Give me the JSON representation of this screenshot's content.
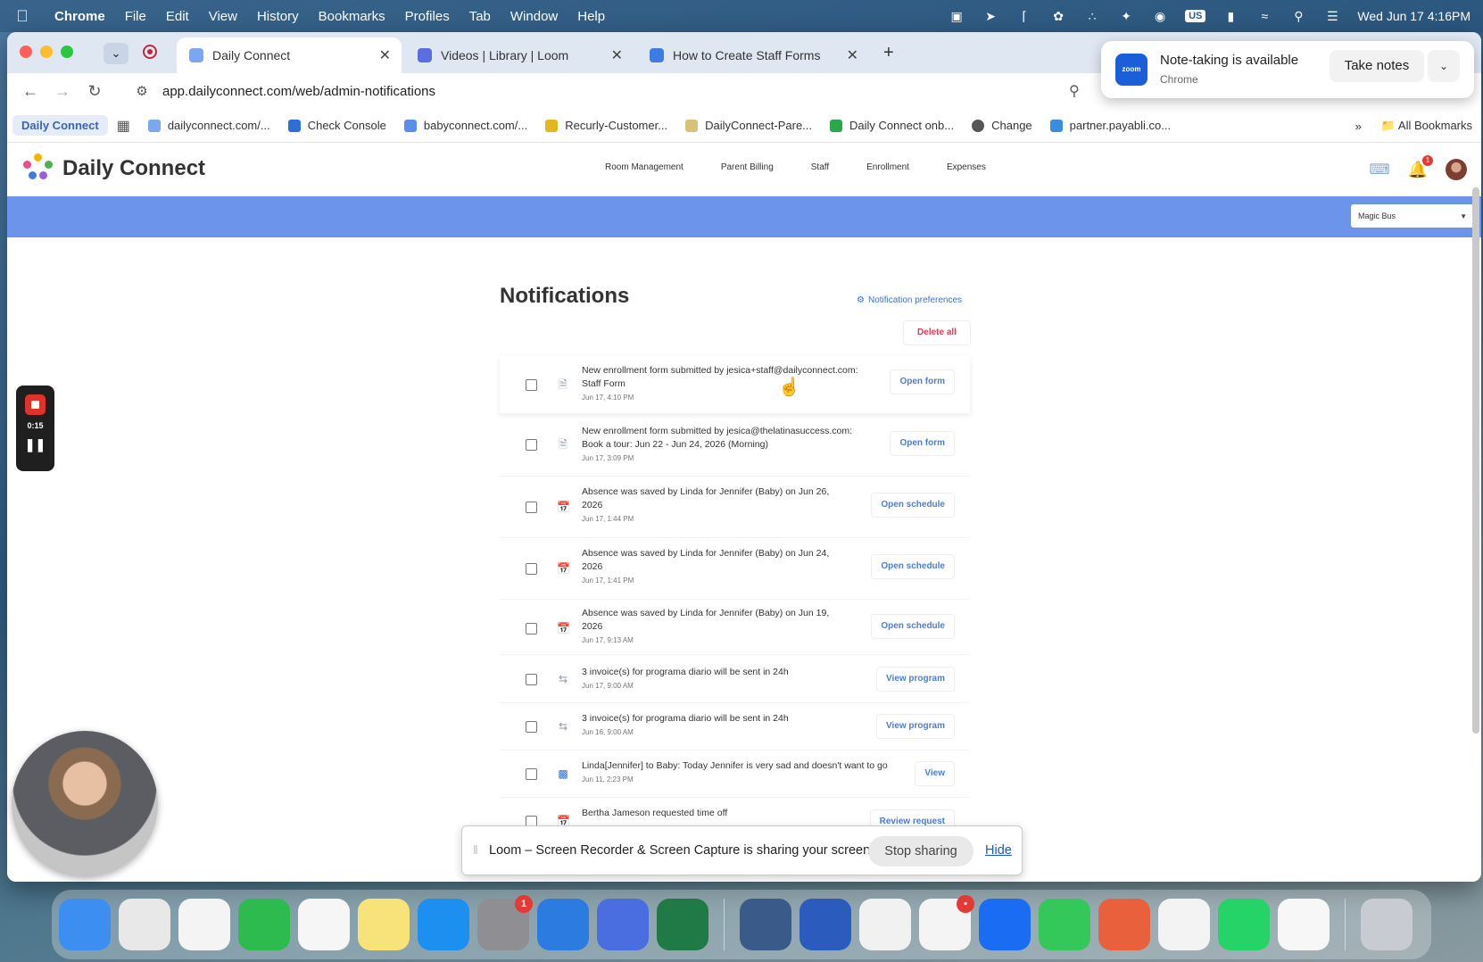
{
  "menubar": {
    "app": "Chrome",
    "items": [
      "File",
      "Edit",
      "View",
      "History",
      "Bookmarks",
      "Profiles",
      "Tab",
      "Window",
      "Help"
    ],
    "input_source": "US",
    "datetime": "Wed Jun 17  4:16PM"
  },
  "tabs": [
    {
      "title": "Daily Connect",
      "color": "#7aa7f0"
    },
    {
      "title": "Videos | Library | Loom",
      "color": "#5b6ee1"
    },
    {
      "title": "How to Create Staff Forms",
      "color": "#3f7be0"
    }
  ],
  "address": {
    "url": "app.dailyconnect.com/web/admin-notifications"
  },
  "bookmarks": [
    {
      "label": "Daily Connect"
    },
    {
      "label": "dailyconnect.com/...",
      "color": "#7aa7f0"
    },
    {
      "label": "Check Console",
      "color": "#2d6fd6"
    },
    {
      "label": "babyconnect.com/...",
      "color": "#5a8ee8"
    },
    {
      "label": "Recurly-Customer...",
      "color": "#e3b81d"
    },
    {
      "label": "DailyConnect-Pare...",
      "color": "#d8c27a"
    },
    {
      "label": "Daily Connect onb...",
      "color": "#2aa84a"
    },
    {
      "label": "Change",
      "color": "#555555"
    },
    {
      "label": "partner.payabli.co...",
      "color": "#3a8ee0"
    }
  ],
  "bookmarks_right": {
    "folder": "All Bookmarks"
  },
  "app": {
    "logo_text": "Daily Connect",
    "nav": [
      "Room Management",
      "Parent Billing",
      "Staff",
      "Enrollment",
      "Expenses"
    ],
    "bell_count": "1",
    "school": "Magic Bus"
  },
  "page": {
    "title": "Notifications",
    "preferences_link": "Notification preferences",
    "delete_all": "Delete all"
  },
  "notifications": [
    {
      "icon": "document-icon",
      "line1": "New enrollment form submitted by jesica+staff@dailyconnect.com:",
      "line2": "Staff Form",
      "time": "Jun 17, 4:10 PM",
      "action": "Open form"
    },
    {
      "icon": "document-icon",
      "line1": "New enrollment form submitted by jesica@thelatinasuccess.com:",
      "line2": "Book a tour: Jun 22 - Jun 24, 2026 (Morning)",
      "time": "Jun 17, 3:09 PM",
      "action": "Open form"
    },
    {
      "icon": "calendar-icon",
      "line1": "Absence was saved by Linda for Jennifer (Baby) on Jun 26,",
      "line2": "2026",
      "time": "Jun 17, 1:44 PM",
      "action": "Open schedule"
    },
    {
      "icon": "calendar-icon",
      "line1": "Absence was saved by Linda for Jennifer (Baby) on Jun 24,",
      "line2": "2026",
      "time": "Jun 17, 1:41 PM",
      "action": "Open schedule"
    },
    {
      "icon": "calendar-icon",
      "line1": "Absence was saved by Linda for Jennifer (Baby) on Jun 19,",
      "line2": "2026",
      "time": "Jun 17, 9:13 AM",
      "action": "Open schedule"
    },
    {
      "icon": "invoice-icon",
      "line1": "3 invoice(s) for programa diario will be sent in 24h",
      "line2": "",
      "time": "Jun 17, 9:00 AM",
      "action": "View program"
    },
    {
      "icon": "invoice-icon",
      "line1": "3 invoice(s) for programa diario will be sent in 24h",
      "line2": "",
      "time": "Jun 16, 9:00 AM",
      "action": "View program"
    },
    {
      "icon": "message-icon",
      "line1": "Linda[Jennifer] to Baby: Today Jennifer is very sad and doesn't want to go",
      "line2": "",
      "time": "Jun 11, 2:23 PM",
      "action": "View"
    },
    {
      "icon": "calendar-icon",
      "line1": "Bertha Jameson requested time off",
      "line2": "",
      "time": "",
      "action": "Review request"
    }
  ],
  "zoom_popup": {
    "logo": "zoom",
    "title": "Note-taking is available",
    "subtitle": "Chrome",
    "button": "Take notes"
  },
  "loom": {
    "timer": "0:15",
    "share_message": "Loom – Screen Recorder & Screen Capture is sharing your screen.",
    "stop_label": "Stop sharing",
    "hide_label": "Hide"
  },
  "dock": [
    {
      "name": "finder",
      "color": "#3c8ff0",
      "badge": ""
    },
    {
      "name": "launchpad",
      "color": "#e8e8e8",
      "badge": ""
    },
    {
      "name": "photos",
      "color": "#f4f4f4",
      "badge": ""
    },
    {
      "name": "numbers",
      "color": "#2dbb4f",
      "badge": ""
    },
    {
      "name": "reminders",
      "color": "#f6f6f6",
      "badge": ""
    },
    {
      "name": "notes",
      "color": "#f8e27a",
      "badge": ""
    },
    {
      "name": "app-store",
      "color": "#1d8ff0",
      "badge": ""
    },
    {
      "name": "system-settings",
      "color": "#8e8e93",
      "badge": "1"
    },
    {
      "name": "files",
      "color": "#2b7be0",
      "badge": ""
    },
    {
      "name": "preview",
      "color": "#4a6ee0",
      "badge": ""
    },
    {
      "name": "excel",
      "color": "#1f7a45",
      "badge": ""
    },
    {
      "name": "screenshot",
      "color": "#3a5a8a",
      "badge": ""
    },
    {
      "name": "word",
      "color": "#2b5cbd",
      "badge": ""
    },
    {
      "name": "chrome",
      "color": "#f1f1f1",
      "badge": ""
    },
    {
      "name": "slack",
      "color": "#f4f4f4",
      "badge": "•"
    },
    {
      "name": "zoom",
      "color": "#1a6cf2",
      "badge": ""
    },
    {
      "name": "messages",
      "color": "#34c759",
      "badge": ""
    },
    {
      "name": "claude",
      "color": "#e8603c",
      "badge": ""
    },
    {
      "name": "asana",
      "color": "#f3f3f3",
      "badge": ""
    },
    {
      "name": "whatsapp",
      "color": "#25d366",
      "badge": ""
    },
    {
      "name": "chatgpt",
      "color": "#f7f7f7",
      "badge": ""
    },
    {
      "name": "trash",
      "color": "#c8ccd2",
      "badge": ""
    }
  ]
}
